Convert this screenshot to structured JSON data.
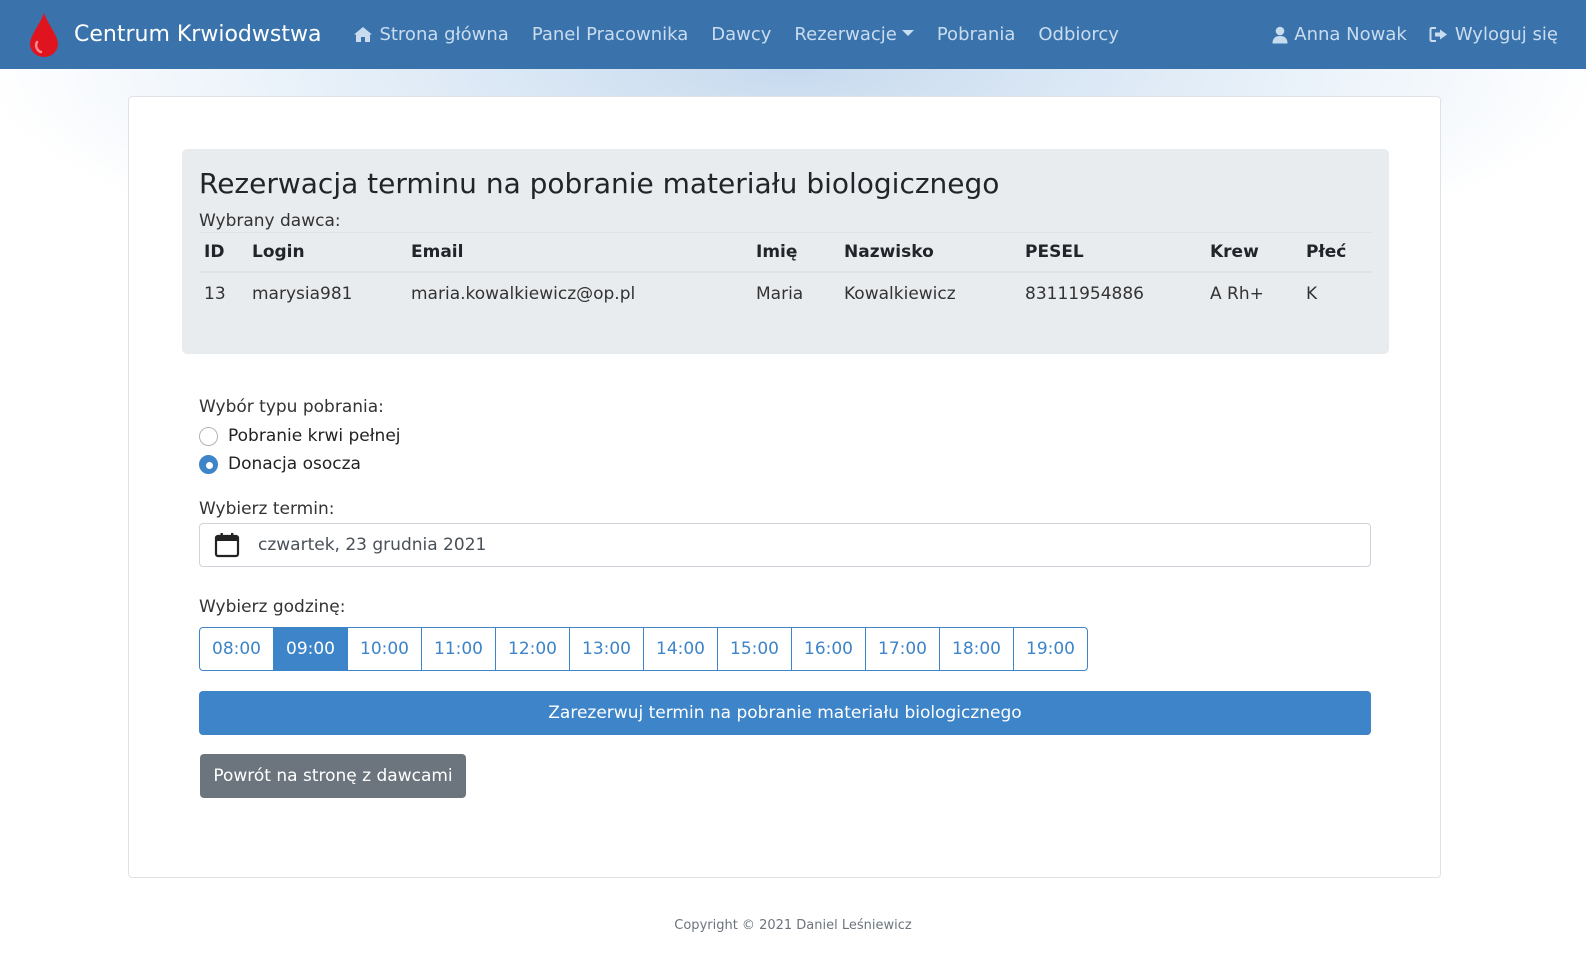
{
  "navbar": {
    "brand": "Centrum Krwiodwstwa",
    "links": {
      "home": "Strona główna",
      "panel": "Panel Pracownika",
      "donors": "Dawcy",
      "reservations": "Rezerwacje",
      "collections": "Pobrania",
      "recipients": "Odbiorcy"
    },
    "user": "Anna Nowak",
    "logout": "Wyloguj się",
    "colors": {
      "bar": "#3a73ac",
      "link": "#c9dcef",
      "brand_drop": "#e0141e"
    },
    "icons": {
      "home": "home-icon",
      "user": "user-icon",
      "logout": "sign-out-icon",
      "brand": "blood-drop-icon"
    }
  },
  "page": {
    "title": "Rezerwacja terminu na pobranie materiału biologicznego",
    "selected_label": "Wybrany dawca:",
    "table": {
      "headers": [
        "ID",
        "Login",
        "Email",
        "Imię",
        "Nazwisko",
        "PESEL",
        "Krew",
        "Płeć"
      ],
      "row": [
        "13",
        "marysia981",
        "maria.kowalkiewicz@op.pl",
        "Maria",
        "Kowalkiewicz",
        "83111954886",
        "A Rh+",
        "K"
      ]
    }
  },
  "form": {
    "type_label": "Wybór typu pobrania:",
    "options": [
      {
        "label": "Pobranie krwi pełnej",
        "checked": false
      },
      {
        "label": "Donacja osocza",
        "checked": true
      }
    ],
    "date_label": "Wybierz termin:",
    "date_value": "czwartek, 23 grudnia 2021",
    "date_icon": "calendar-icon",
    "hour_label": "Wybierz godzinę:",
    "hours": [
      "08:00",
      "09:00",
      "10:00",
      "11:00",
      "12:00",
      "13:00",
      "14:00",
      "15:00",
      "16:00",
      "17:00",
      "18:00",
      "19:00"
    ],
    "selected_hour": "09:00",
    "submit_label": "Zarezerwuj termin na pobranie materiału biologicznego",
    "back_label": "Powrót na stronę z dawcami",
    "colors": {
      "primary": "#3e84c8",
      "secondary": "#6c757d"
    }
  },
  "footer": {
    "text": "Copyright © 2021 Daniel Leśniewicz"
  }
}
